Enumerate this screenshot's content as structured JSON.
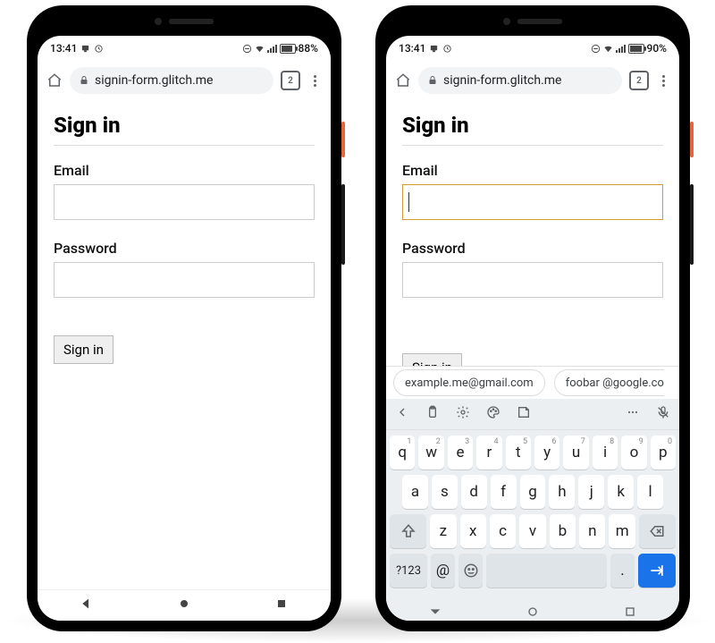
{
  "left": {
    "status": {
      "time": "13:41",
      "battery": "88%"
    },
    "browser": {
      "url": "signin-form.glitch.me",
      "tabcount": "2"
    },
    "page": {
      "heading": "Sign in",
      "email_label": "Email",
      "password_label": "Password",
      "button": "Sign in"
    }
  },
  "right": {
    "status": {
      "time": "13:41",
      "battery": "90%"
    },
    "browser": {
      "url": "signin-form.glitch.me",
      "tabcount": "2"
    },
    "page": {
      "heading": "Sign in",
      "email_label": "Email",
      "password_label": "Password",
      "button": "Sign in"
    },
    "suggestions": [
      "example.me@gmail.com",
      "foobar @google.co"
    ],
    "keyboard": {
      "row1": [
        {
          "k": "q",
          "n": "1"
        },
        {
          "k": "w",
          "n": "2"
        },
        {
          "k": "e",
          "n": "3"
        },
        {
          "k": "r",
          "n": "4"
        },
        {
          "k": "t",
          "n": "5"
        },
        {
          "k": "y",
          "n": "6"
        },
        {
          "k": "u",
          "n": "7"
        },
        {
          "k": "i",
          "n": "8"
        },
        {
          "k": "o",
          "n": "9"
        },
        {
          "k": "p",
          "n": "0"
        }
      ],
      "row2": [
        "a",
        "s",
        "d",
        "f",
        "g",
        "h",
        "j",
        "k",
        "l"
      ],
      "row3": [
        "z",
        "x",
        "c",
        "v",
        "b",
        "n",
        "m"
      ],
      "sym": "?123",
      "at": "@",
      "period": "."
    }
  }
}
